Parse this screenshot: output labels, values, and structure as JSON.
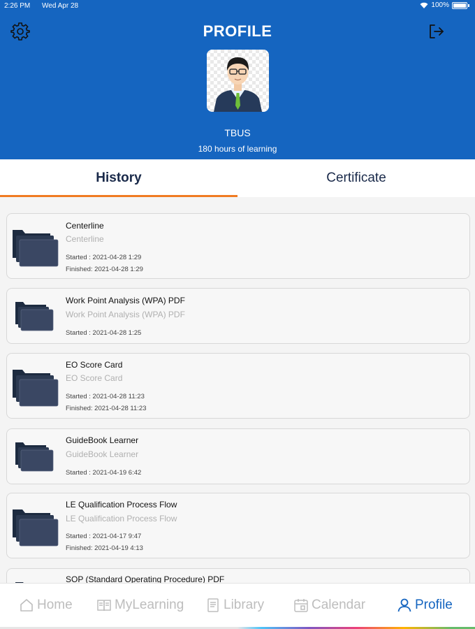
{
  "status_bar": {
    "time": "2:26 PM",
    "date": "Wed Apr 28",
    "battery": "100%"
  },
  "header": {
    "title": "PROFILE",
    "user_name": "TBUS",
    "hours": "180 hours of learning",
    "settings_icon": "gear-icon",
    "logout_icon": "logout-icon",
    "background_color": "#1565c0"
  },
  "tabs": [
    {
      "label": "History",
      "active": true
    },
    {
      "label": "Certificate",
      "active": false
    }
  ],
  "history": [
    {
      "title": "Centerline",
      "subtitle": "Centerline",
      "started": "Started : 2021-04-28 1:29",
      "finished": "Finished: 2021-04-28 1:29"
    },
    {
      "title": "Work Point Analysis (WPA) PDF",
      "subtitle": "Work Point Analysis (WPA) PDF",
      "started": "Started : 2021-04-28 1:25"
    },
    {
      "title": "EO Score Card",
      "subtitle": "EO Score Card",
      "started": "Started : 2021-04-28 11:23",
      "finished": "Finished: 2021-04-28 11:23"
    },
    {
      "title": "GuideBook Learner",
      "subtitle": "GuideBook Learner",
      "started": "Started : 2021-04-19 6:42"
    },
    {
      "title": "LE Qualification Process Flow",
      "subtitle": "LE Qualification Process Flow",
      "started": "Started : 2021-04-17 9:47",
      "finished": "Finished: 2021-04-19 4:13"
    },
    {
      "title": "SOP (Standard Operating Procedure) PDF"
    }
  ],
  "tabbar": {
    "items": [
      {
        "label": "Home",
        "icon": "home-icon"
      },
      {
        "label": "MyLearning",
        "icon": "book-icon"
      },
      {
        "label": "Library",
        "icon": "library-icon"
      },
      {
        "label": "Calendar",
        "icon": "calendar-icon"
      },
      {
        "label": "Profile",
        "icon": "person-icon",
        "active": true
      }
    ],
    "active_color": "#1565c0",
    "inactive_color": "#bdbdbd"
  }
}
